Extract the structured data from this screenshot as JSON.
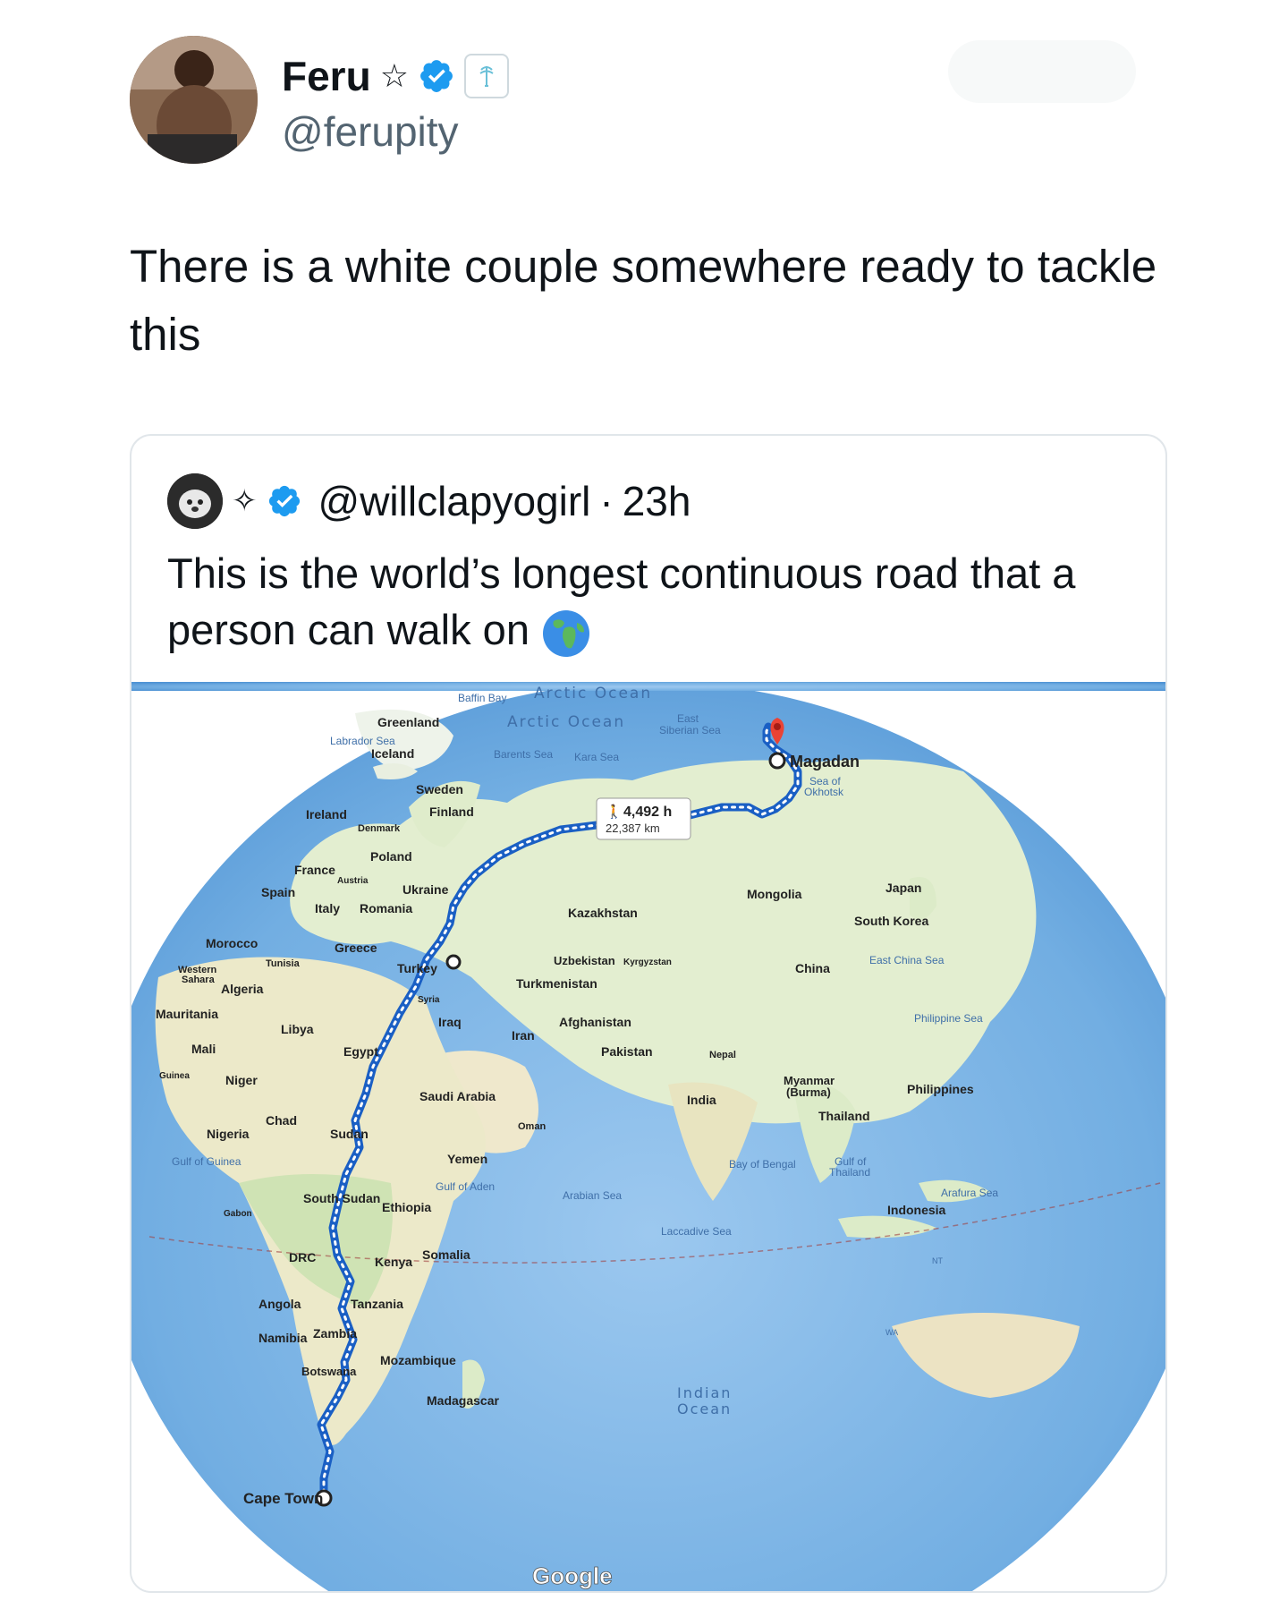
{
  "author": {
    "name": "Feru",
    "handle": "@ferupity"
  },
  "tweet": {
    "text": "There is a white couple somewhere ready to tackle this"
  },
  "quoted": {
    "handle": "@willclapyogirl",
    "separator": "·",
    "time": "23h",
    "text": "This is the world’s longest continuous road that a person can walk on"
  },
  "map": {
    "route_duration": "4,492 h",
    "route_distance": "22,387 km",
    "start": "Cape Town",
    "end": "Magadan",
    "brand": "Google",
    "oceans": [
      "Arctic Ocean",
      "Arctic Ocean",
      "Indian Ocean"
    ],
    "seas": [
      "Baffin Bay",
      "Labrador Sea",
      "Barents Sea",
      "Kara Sea",
      "East Siberian Sea",
      "Sea of Okhotsk",
      "East China Sea",
      "Philippine Sea",
      "Gulf of Guinea",
      "Gulf of Aden",
      "Arabian Sea",
      "Laccadive Sea",
      "Bay of Bengal",
      "Gulf of Thailand",
      "Arafura Sea"
    ],
    "countries": [
      "Greenland",
      "Iceland",
      "Sweden",
      "Finland",
      "Ireland",
      "Denmark",
      "Poland",
      "France",
      "Austria",
      "Spain",
      "Italy",
      "Romania",
      "Ukraine",
      "Kazakhstan",
      "Mongolia",
      "Japan",
      "South Korea",
      "Morocco",
      "Greece",
      "Tunisia",
      "Western Sahara",
      "Algeria",
      "Turkey",
      "Uzbekistan",
      "Kyrgyzstan",
      "Turkmenistan",
      "China",
      "Mauritania",
      "Libya",
      "Syria",
      "Iraq",
      "Iran",
      "Afghanistan",
      "Mali",
      "Egypt",
      "Pakistan",
      "Nepal",
      "Guinea",
      "Niger",
      "Saudi Arabia",
      "Myanmar (Burma)",
      "India",
      "Philippines",
      "Chad",
      "Oman",
      "Thailand",
      "Nigeria",
      "Sudan",
      "Yemen",
      "South Sudan",
      "Ethiopia",
      "Gabon",
      "Indonesia",
      "DRC",
      "Kenya",
      "Somalia",
      "Angola",
      "Tanzania",
      "Namibia",
      "Zambia",
      "Mozambique",
      "Botswana",
      "Madagascar",
      "NT",
      "WA"
    ]
  },
  "colors": {
    "verified": "#1d9bf0",
    "route": "#1a73e8",
    "text": "#0f1419",
    "secondary": "#536471",
    "ocean": "#7fb0e0",
    "land": "#e6efd6"
  }
}
